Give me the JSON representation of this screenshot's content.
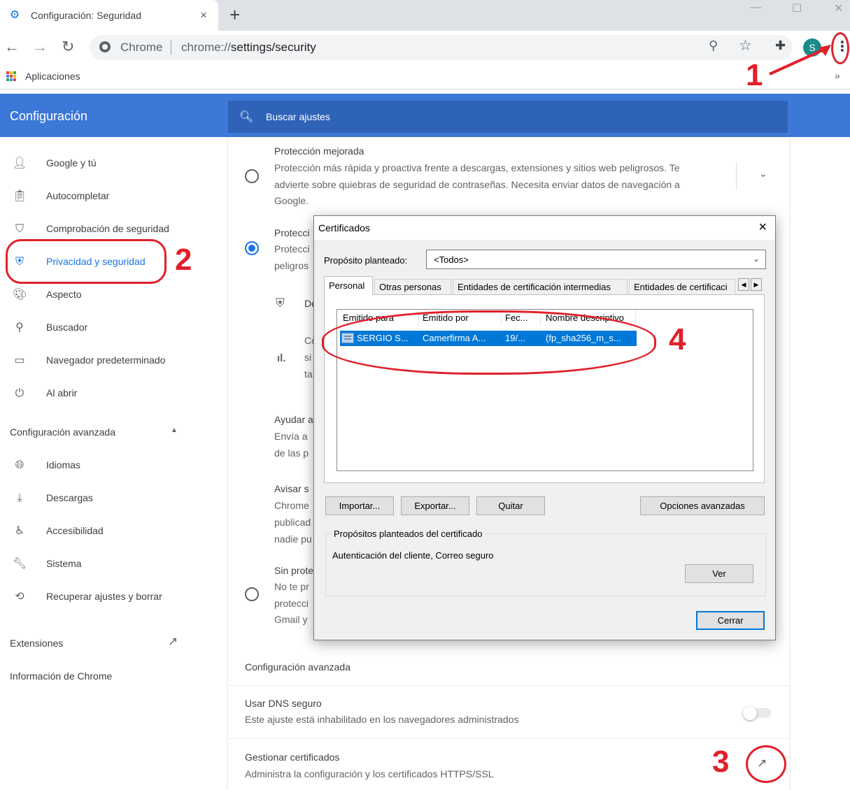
{
  "browser": {
    "tab_title": "Configuración: Seguridad",
    "tab_close": "×",
    "new_tab": "+",
    "omnibox_site": "Chrome",
    "url_host": "chrome://",
    "url_path": "settings/security",
    "avatar_letter": "S",
    "bookmarks_label": "Aplicaciones",
    "bookmarks_overflow": "»"
  },
  "header": {
    "title": "Configuración",
    "search_placeholder": "Buscar ajustes"
  },
  "sidebar": {
    "items": [
      {
        "label": "Google y tú",
        "icon": "person-icon"
      },
      {
        "label": "Autocompletar",
        "icon": "clipboard-icon"
      },
      {
        "label": "Comprobación de seguridad",
        "icon": "shield-check-icon"
      },
      {
        "label": "Privacidad y seguridad",
        "icon": "shield-icon"
      },
      {
        "label": "Aspecto",
        "icon": "palette-icon"
      },
      {
        "label": "Buscador",
        "icon": "search-icon"
      },
      {
        "label": "Navegador predeterminado",
        "icon": "browser-icon"
      },
      {
        "label": "Al abrir",
        "icon": "power-icon"
      }
    ],
    "advanced_heading": "Configuración avanzada",
    "advanced_items": [
      {
        "label": "Idiomas",
        "icon": "globe-icon"
      },
      {
        "label": "Descargas",
        "icon": "download-icon"
      },
      {
        "label": "Accesibilidad",
        "icon": "accessibility-icon"
      },
      {
        "label": "Sistema",
        "icon": "wrench-icon"
      },
      {
        "label": "Recuperar ajustes y borrar",
        "icon": "restore-icon"
      }
    ],
    "extensions": "Extensiones",
    "about": "Información de Chrome"
  },
  "main": {
    "enhanced_title": "Protección mejorada",
    "enhanced_desc_1": "Protección más rápida y proactiva frente a descargas, extensiones y sitios web peligrosos. Te",
    "enhanced_desc_2": "advierte sobre quiebras de seguridad de contraseñas. Necesita enviar datos de navegación a",
    "enhanced_desc_3": "Google.",
    "standard_title_partial": "Protecci",
    "standard_desc_partial_1": "Protecci",
    "standard_desc_partial_2": "peligros",
    "standard_sub_partial": "De",
    "standard_c_partial": "Co",
    "standard_si_partial": "si",
    "standard_ta_partial": "ta",
    "help_partial_1": "Ayudar a",
    "help_partial_2": "Envía a",
    "help_partial_3": "de las p",
    "warn_partial_1": "Avisar s",
    "warn_partial_2": "Chrome",
    "warn_partial_3": "publicad",
    "warn_partial_4": "nadie pu",
    "none_partial_1": "Sin prote",
    "none_partial_2": "No te pr",
    "none_partial_3": "protecci",
    "none_partial_4": "Gmail y",
    "advanced_section": "Configuración avanzada",
    "dns_title": "Usar DNS seguro",
    "dns_desc": "Este ajuste está inhabilitado en los navegadores administrados",
    "certs_title": "Gestionar certificados",
    "certs_desc": "Administra la configuración y los certificados HTTPS/SSL"
  },
  "dialog": {
    "title": "Certificados",
    "close": "×",
    "purpose_label": "Propósito planteado:",
    "purpose_value": "<Todos>",
    "tabs": [
      "Personal",
      "Otras personas",
      "Entidades de certificación intermedias",
      "Entidades de certificaci"
    ],
    "columns": [
      "Emitido para",
      "Emitido por",
      "Fec...",
      "Nombre descriptivo"
    ],
    "rows": [
      {
        "issued_to": "SERGIO S...",
        "issued_by": "Camerfirma A...",
        "date": "19/...",
        "friendly_name": "(fp_sha256_m_s..."
      }
    ],
    "btn_import": "Importar...",
    "btn_export": "Exportar...",
    "btn_remove": "Quitar",
    "btn_advanced": "Opciones avanzadas",
    "purposes_group": "Propósitos planteados del certificado",
    "purposes_value": "Autenticación del cliente, Correo seguro",
    "btn_view": "Ver",
    "btn_close": "Cerrar"
  },
  "annotations": [
    "1",
    "2",
    "3",
    "4"
  ],
  "colors": {
    "accent": "#1a73e8",
    "header_blue": "#3c78d8",
    "annotation_red": "#e0202a",
    "selection_blue": "#0078d7"
  }
}
